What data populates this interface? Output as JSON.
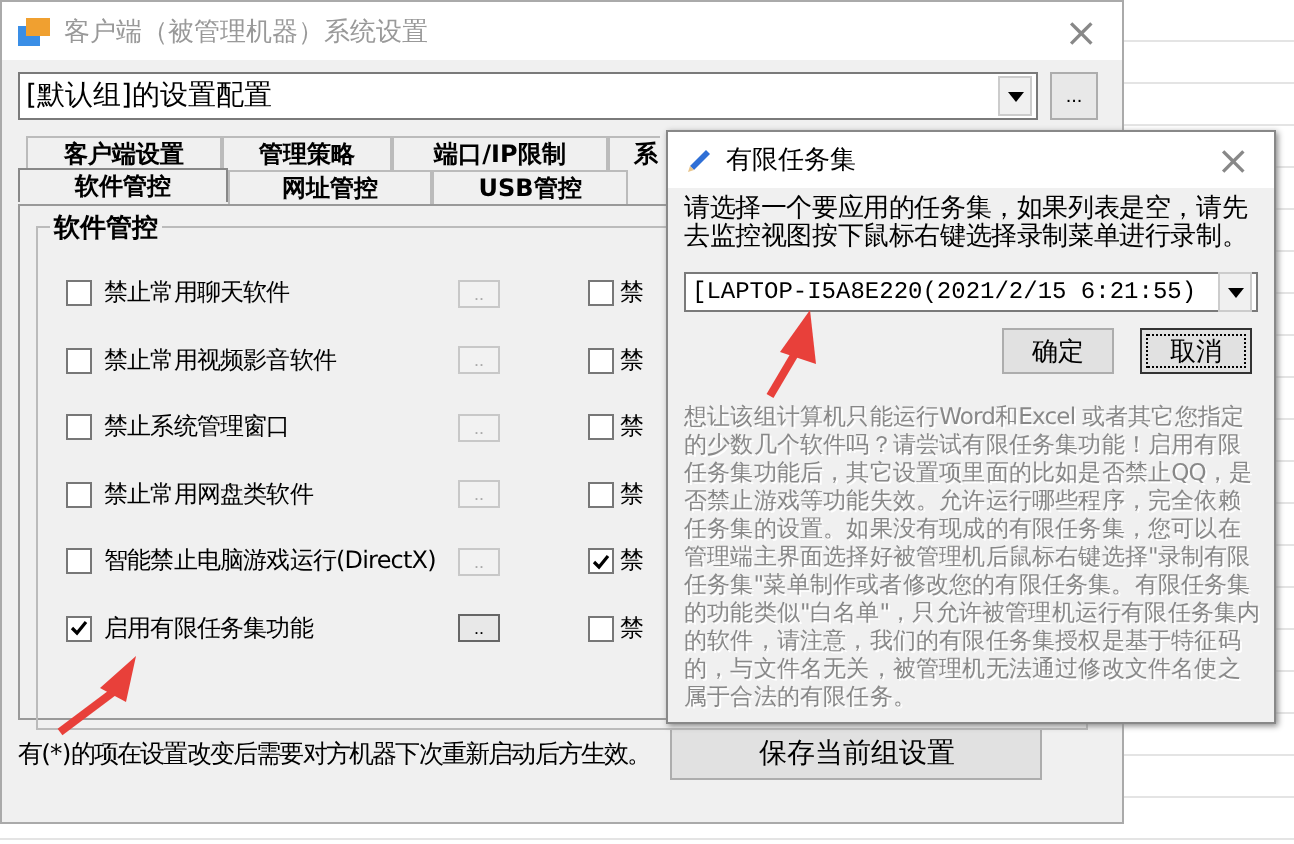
{
  "main_window": {
    "title": "客户端（被管理机器）系统设置",
    "close": "×",
    "profile_combo": {
      "value": "[默认组]的设置配置",
      "more_button": "..."
    },
    "tabs_row_1": [
      {
        "label": "客户端设置",
        "selected": false
      },
      {
        "label": "管理策略",
        "selected": false
      },
      {
        "label": "端口/IP限制",
        "selected": false
      },
      {
        "label": "系",
        "selected": false
      }
    ],
    "tabs_row_2": [
      {
        "label": "软件管控",
        "selected": true
      },
      {
        "label": "网址管控",
        "selected": false
      },
      {
        "label": "USB管控",
        "selected": false
      }
    ],
    "group_title": "软件管控",
    "options": [
      {
        "label": "禁止常用聊天软件",
        "checked": false,
        "button": "..",
        "button_enabled": false,
        "right_label": "禁",
        "right_checked": false
      },
      {
        "label": "禁止常用视频影音软件",
        "checked": false,
        "button": "..",
        "button_enabled": false,
        "right_label": "禁",
        "right_checked": false
      },
      {
        "label": "禁止系统管理窗口",
        "checked": false,
        "button": "..",
        "button_enabled": false,
        "right_label": "禁",
        "right_checked": false
      },
      {
        "label": "禁止常用网盘类软件",
        "checked": false,
        "button": "..",
        "button_enabled": false,
        "right_label": "禁",
        "right_checked": false
      },
      {
        "label": "智能禁止电脑游戏运行(DirectX)",
        "checked": false,
        "button": "..",
        "button_enabled": false,
        "right_label": "禁",
        "right_checked": true
      },
      {
        "label": "启用有限任务集功能",
        "checked": true,
        "button": "..",
        "button_enabled": true,
        "right_label": "禁",
        "right_checked": false
      }
    ],
    "footnote": "有(*)的项在设置改变后需要对方机器下次重新启动后方生效。",
    "save_button": "保存当前组设置"
  },
  "dialog": {
    "title": "有限任务集",
    "close": "×",
    "prompt": "请选择一个要应用的任务集，如果列表是空，请先去监控视图按下鼠标右键选择录制菜单进行录制。",
    "task_combo": {
      "value": "[LAPTOP-I5A8E220(2021/2/15 6:21:55)"
    },
    "buttons": [
      {
        "label": "确定",
        "focused": false
      },
      {
        "label": "取消",
        "focused": true
      }
    ],
    "description": "想让该组计算机只能运行Word和Excel 或者其它您指定的少数几个软件吗？请尝试有限任务集功能！启用有限任务集功能后，其它设置项里面的比如是否禁止QQ，是否禁止游戏等功能失效。允许运行哪些程序，完全依赖任务集的设置。如果没有现成的有限任务集，您可以在管理端主界面选择好被管理机后鼠标右键选择\"录制有限任务集\"菜单制作或者修改您的有限任务集。有限任务集的功能类似\"白名单\"，只允许被管理机运行有限任务集内的软件，请注意，我们的有限任务集授权是基于特征码的，与文件名无关，被管理机无法通过修改文件名使之属于合法的有限任务。"
  }
}
